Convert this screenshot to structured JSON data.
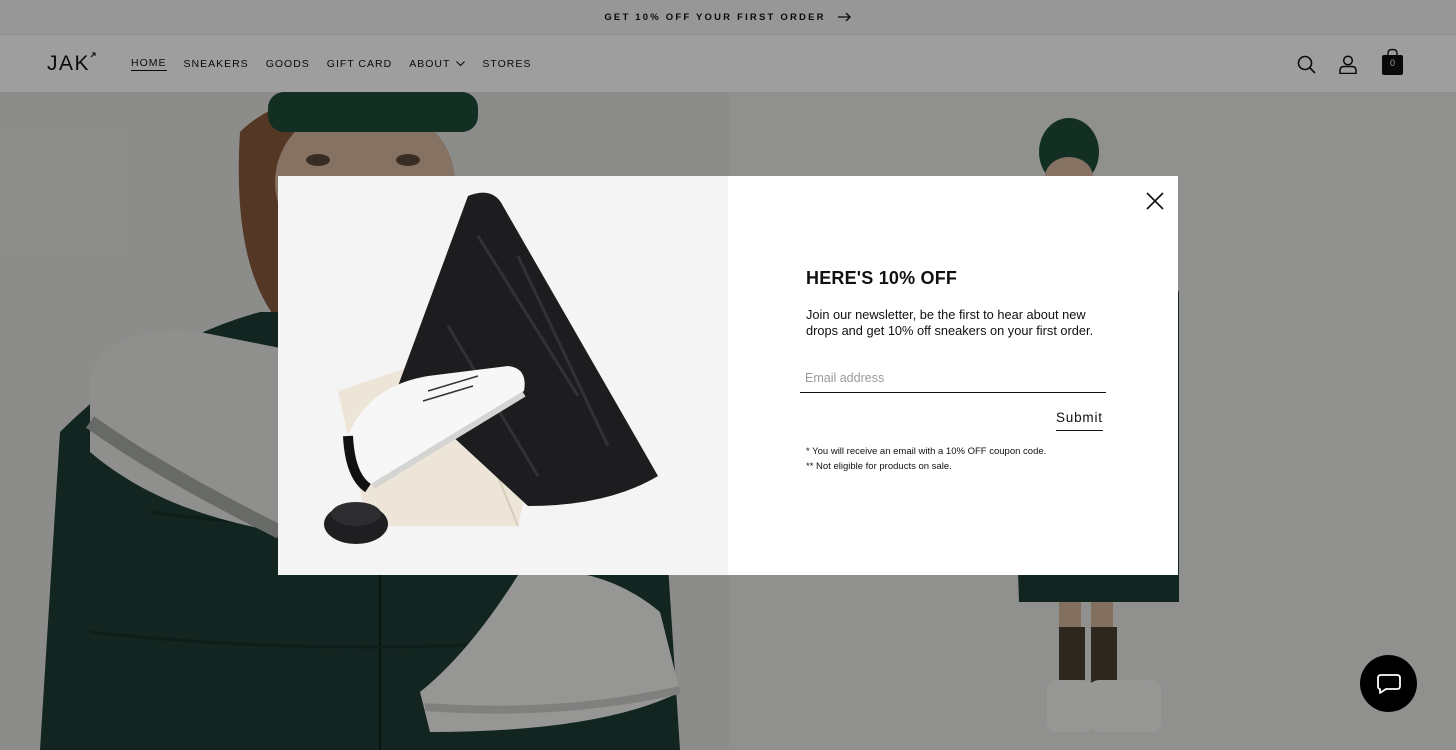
{
  "announcement": {
    "text": "GET 10% OFF YOUR FIRST ORDER",
    "icon": "arrow-right-icon"
  },
  "header": {
    "logo": "JAK",
    "nav": [
      {
        "label": "HOME",
        "active": true
      },
      {
        "label": "SNEAKERS"
      },
      {
        "label": "GOODS"
      },
      {
        "label": "GIFT CARD"
      },
      {
        "label": "ABOUT",
        "has_dropdown": true
      },
      {
        "label": "STORES"
      }
    ],
    "icons": [
      "search-icon",
      "account-icon",
      "cart-icon"
    ],
    "cart_count": "0"
  },
  "modal": {
    "title": "HERE'S 10% OFF",
    "description": "Join our newsletter, be the first to hear about new drops and get 10% off sneakers on your first order.",
    "email_placeholder": "Email address",
    "submit_label": "Submit",
    "note1": "* You will receive an email with a 10% OFF coupon code.",
    "note2": "** Not eligible for products on sale."
  },
  "chat": {
    "icon": "chat-bubble-icon"
  },
  "colors": {
    "overlay": "#000000",
    "accent": "#111111",
    "green": "#1f3d34"
  }
}
